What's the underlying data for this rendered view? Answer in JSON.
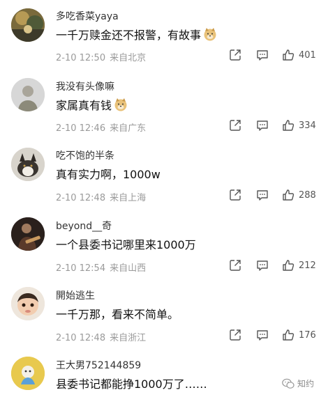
{
  "comments": [
    {
      "username": "多吃香菜yaya",
      "text": "一千万赎金还不报警，有故事",
      "emoji": "doge",
      "time": "2-10 12:50",
      "location": "来自北京",
      "likes": "401"
    },
    {
      "username": "我没有头像嘛",
      "text": "家属真有钱",
      "emoji": "doge",
      "time": "2-10 12:46",
      "location": "来自广东",
      "likes": "334"
    },
    {
      "username": "吃不饱的半条",
      "text": "真有实力啊，1000w",
      "emoji": "",
      "time": "2-10 12:48",
      "location": "来自上海",
      "likes": "288"
    },
    {
      "username": "beyond__奇",
      "text": "一个县委书记哪里来1000万",
      "emoji": "",
      "time": "2-10 12:54",
      "location": "来自山西",
      "likes": "212"
    },
    {
      "username": "開始逃生",
      "text": "一千万那，看来不简单。",
      "emoji": "",
      "time": "2-10 12:48",
      "location": "来自浙江",
      "likes": "176"
    },
    {
      "username": "王大男752144859",
      "text": "县委书记都能挣1000万了……",
      "emoji": "",
      "time": "",
      "location": "",
      "likes": ""
    }
  ],
  "watermark": {
    "label": "知约"
  },
  "icons": {
    "share": "share-icon",
    "reply": "comment-icon",
    "like": "thumbs-up-icon",
    "emoji": "doge-emoji-icon"
  }
}
